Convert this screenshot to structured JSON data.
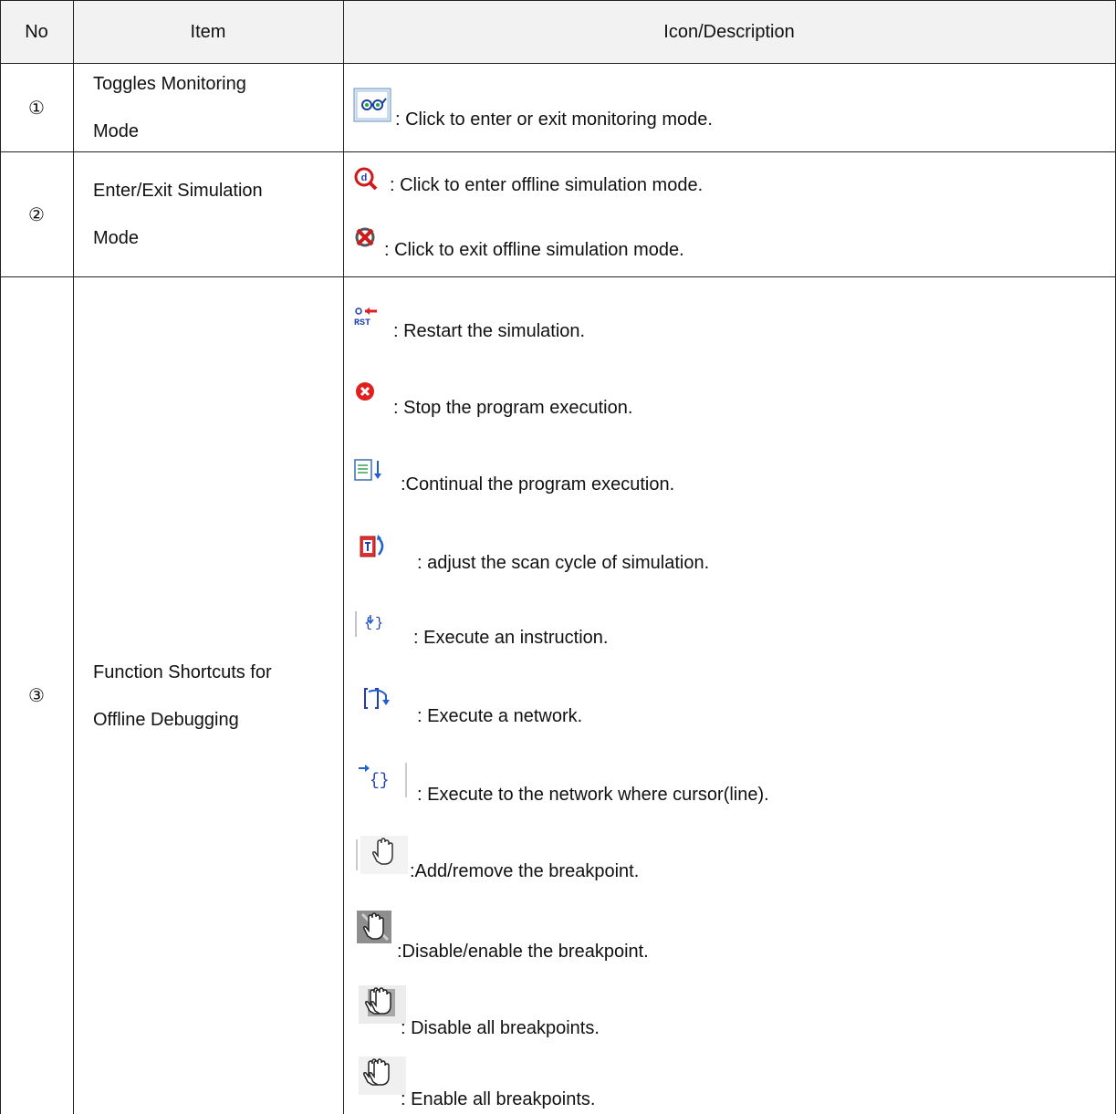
{
  "table": {
    "headers": {
      "no": "No",
      "item": "Item",
      "desc": "Icon/Description"
    },
    "rows": [
      {
        "no": "①",
        "item_line1": "Toggles Monitoring",
        "item_line2": "Mode",
        "entries": [
          {
            "icon": "glasses-monitor-icon",
            "text": ": Click to enter or exit monitoring mode."
          }
        ]
      },
      {
        "no": "②",
        "item_line1": "Enter/Exit Simulation",
        "item_line2": "Mode",
        "entries": [
          {
            "icon": "simulation-enter-icon",
            "text": ": Click to enter offline simulation mode."
          },
          {
            "icon": "simulation-exit-icon",
            "text": ": Click to exit offline simulation mode."
          }
        ]
      },
      {
        "no": "③",
        "item_line1": "Function Shortcuts for",
        "item_line2": "Offline Debugging",
        "entries": [
          {
            "icon": "restart-rst-icon",
            "text": ": Restart the simulation."
          },
          {
            "icon": "stop-icon",
            "text": ": Stop the program execution."
          },
          {
            "icon": "continue-execution-icon",
            "text": ":Continual the program execution."
          },
          {
            "icon": "scan-cycle-icon",
            "text": ": adjust the scan cycle of simulation."
          },
          {
            "icon": "step-instruction-icon",
            "text": ": Execute an instruction."
          },
          {
            "icon": "step-network-icon",
            "text": ": Execute a network."
          },
          {
            "icon": "run-to-cursor-icon",
            "text": ": Execute to the network where cursor(line)."
          },
          {
            "icon": "breakpoint-toggle-icon",
            "text": ":Add/remove the breakpoint."
          },
          {
            "icon": "breakpoint-disable-enable-icon",
            "text": ":Disable/enable the breakpoint."
          },
          {
            "icon": "disable-all-breakpoints-icon",
            "text": ": Disable all breakpoints."
          },
          {
            "icon": "enable-all-breakpoints-icon",
            "text": ": Enable all breakpoints."
          }
        ]
      }
    ]
  },
  "colors": {
    "border": "#222222",
    "header_bg": "#f2f2f2",
    "icon_blue": "#1f5fd0",
    "icon_red": "#e02020"
  }
}
